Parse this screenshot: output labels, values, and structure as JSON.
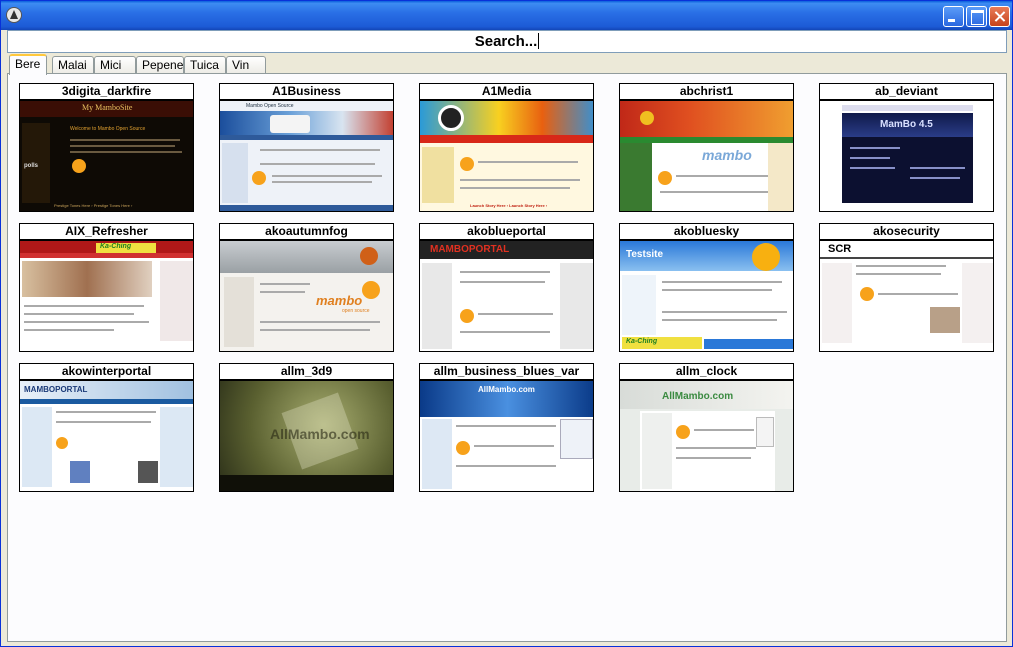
{
  "search": {
    "text": "Search..."
  },
  "tabs": [
    {
      "label": "Bere",
      "active": true
    },
    {
      "label": "Malai",
      "active": false
    },
    {
      "label": "Mici",
      "active": false
    },
    {
      "label": "Pepene",
      "active": false
    },
    {
      "label": "Tuica",
      "active": false
    },
    {
      "label": "Vin",
      "active": false
    }
  ],
  "templates": [
    {
      "name": "3digita_darkfire"
    },
    {
      "name": "A1Business"
    },
    {
      "name": "A1Media"
    },
    {
      "name": "abchrist1"
    },
    {
      "name": "ab_deviant"
    },
    {
      "name": "AIX_Refresher"
    },
    {
      "name": "akoautumnfog"
    },
    {
      "name": "akoblueportal"
    },
    {
      "name": "akobluesky"
    },
    {
      "name": "akosecurity"
    },
    {
      "name": "akowinterportal"
    },
    {
      "name": "allm_3d9"
    },
    {
      "name": "allm_business_blues_var"
    },
    {
      "name": "allm_clock"
    }
  ],
  "thumb_text": {
    "darkfire_header": "My MamboSite",
    "darkfire_welcome": "Welcome to Mambo Open Source",
    "darkfire_polls": "polls",
    "darkfire_footer": "Prestige Tones Here ›   Prestige Tones Here ›",
    "a1business_banner": "Mambo Open Source",
    "autumnfog_brand": "mambo",
    "autumnfog_brand_sub": "open source",
    "blueportal_logo": "MAMBOPORTAL",
    "bluesky_logo": "Testsite",
    "bluesky_banner": "Ka-Ching",
    "aix_banner": "Ka-Ching",
    "security_logo": "SCR",
    "deviant_logo": "MamBo 4.5",
    "abchrist_brand": "mambo",
    "winterportal_logo": "MAMBOPORTAL",
    "allm3d9_text": "AllMambo.com",
    "blues_logo": "AllMambo.com",
    "clock_logo": "AllMambo.com",
    "a1media_footer": "Launch Story Here ›   Launch Story Here ›"
  }
}
